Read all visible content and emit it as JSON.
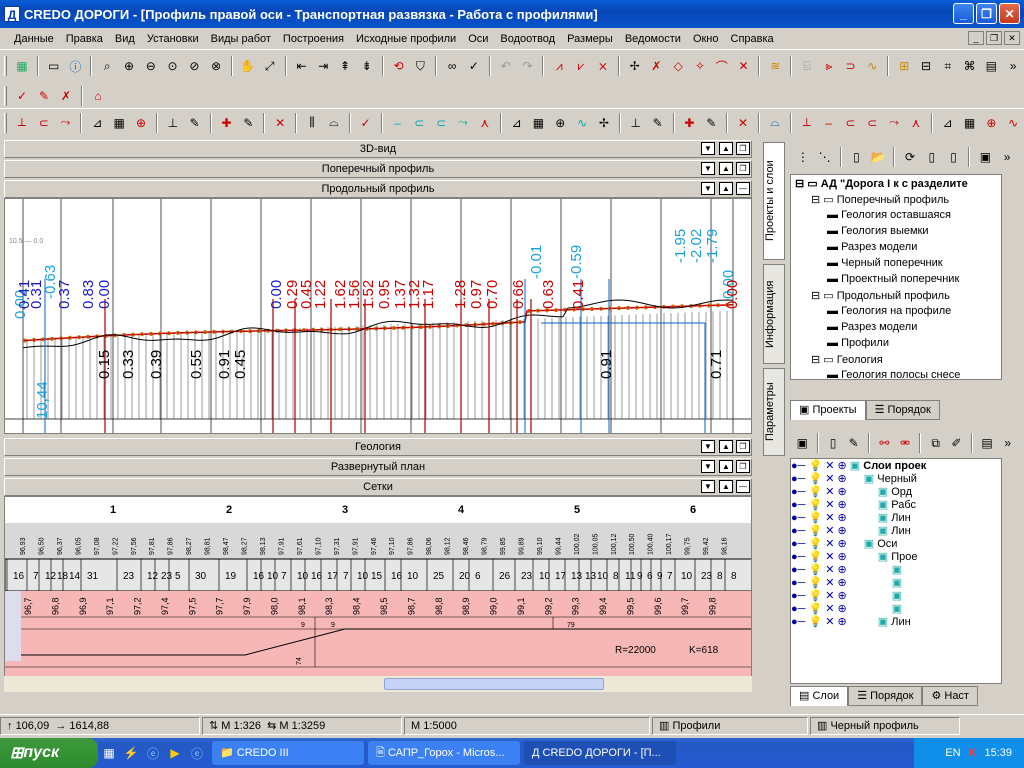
{
  "window": {
    "title": "CREDO ДОРОГИ - [Профиль правой оси - Транспортная развязка - Работа с профилями]",
    "app_icon": "Д"
  },
  "menu": [
    "Данные",
    "Правка",
    "Вид",
    "Установки",
    "Виды работ",
    "Построения",
    "Исходные профили",
    "Оси",
    "Водоотвод",
    "Размеры",
    "Ведомости",
    "Окно",
    "Справка"
  ],
  "panels": {
    "view3d": "3D-вид",
    "cross": "Поперечный профиль",
    "longitudinal": "Продольный профиль",
    "geology": "Геология",
    "plan": "Развернутый план",
    "grids": "Сетки"
  },
  "profile": {
    "blue_labels": [
      "-0.01",
      "-0.59",
      "-1.95",
      "-2.02",
      "-1.79",
      "0.00",
      "-0.63",
      "0.00",
      "10,44"
    ],
    "red_labels": [
      "0.41",
      "0.31",
      "0.37",
      "0.83",
      "0.00",
      "0.00",
      "0.29",
      "0.45",
      "1.22",
      "1.62",
      "1.56",
      "1.52",
      "0.95",
      "1.37",
      "1.32",
      "1.17",
      "1.28",
      "0.97",
      "0.70",
      "0.66",
      "0.63",
      "0.41",
      "0.00"
    ],
    "black_labels": [
      "0.15",
      "0.33",
      "0.39",
      "0.55",
      "0.91",
      "0.45",
      "0.91",
      "0.71"
    ],
    "top_tick": "10.5 — 0.0"
  },
  "grid": {
    "km_marks": [
      "1",
      "2",
      "3",
      "4",
      "5",
      "6"
    ],
    "top_values": [
      "96,93",
      "96,50",
      "96,37",
      "96,05",
      "97,08",
      "97,22",
      "97,56",
      "97,81",
      "97,86",
      "98,27",
      "98,81",
      "98,47",
      "98,27",
      "98,13",
      "97,91",
      "97,61",
      "97,10",
      "97,31",
      "97,91",
      "97,46",
      "97,10",
      "97,86",
      "98,06",
      "98,12",
      "98,46",
      "98,79",
      "99,85",
      "99,89",
      "99,10",
      "99,44",
      "100,02",
      "100,05",
      "100,12",
      "100,50",
      "100,40",
      "100,17",
      "99,75",
      "99,42",
      "98,16"
    ],
    "segments": [
      "16",
      "7",
      "12",
      "18",
      "14",
      "31",
      "23",
      "12",
      "23",
      "5",
      "30",
      "19",
      "16",
      "10",
      "7",
      "10",
      "16",
      "17",
      "7",
      "10",
      "15",
      "16",
      "10",
      "25",
      "20",
      "6",
      "26",
      "23",
      "10",
      "17",
      "13",
      "13",
      "10",
      "8",
      "11",
      "9",
      "6",
      "9",
      "7",
      "10",
      "23",
      "8",
      "8"
    ],
    "pink_values": [
      "96,7",
      "96,8",
      "96,9",
      "97,1",
      "97,2",
      "97,4",
      "97,5",
      "97,7",
      "97,9",
      "98,0",
      "98,1",
      "98,3",
      "98,4",
      "98,5",
      "98,7",
      "98,8",
      "98,9",
      "99,0",
      "99,1",
      "99,2",
      "99,3",
      "99,4",
      "99,5",
      "99,6",
      "99,7",
      "99,8"
    ],
    "lower_numbers": [
      "9",
      "9",
      "79",
      "74"
    ],
    "radius": "R=22000",
    "k": "K=618"
  },
  "right": {
    "vtabs": [
      "Проекты и слои",
      "Информация",
      "Параметры"
    ],
    "tree": [
      {
        "label": "АД \"Дорога I к с разделите",
        "depth": 0,
        "bold": true
      },
      {
        "label": "Поперечный профиль",
        "depth": 1
      },
      {
        "label": "Геология оставшаяся",
        "depth": 2
      },
      {
        "label": "Геология выемки",
        "depth": 2
      },
      {
        "label": "Разрез модели",
        "depth": 2
      },
      {
        "label": "Черный поперечник",
        "depth": 2
      },
      {
        "label": "Проектный поперечник",
        "depth": 2
      },
      {
        "label": "Продольный профиль",
        "depth": 1
      },
      {
        "label": "Геология на профиле",
        "depth": 2
      },
      {
        "label": "Разрез модели",
        "depth": 2
      },
      {
        "label": "Профили",
        "depth": 2
      },
      {
        "label": "Геология",
        "depth": 1
      },
      {
        "label": "Геология полосы снесе",
        "depth": 2
      }
    ],
    "tabs_top": [
      "Проекты",
      "Порядок"
    ],
    "layers": [
      {
        "label": "Слои проек",
        "depth": 0,
        "bold": true
      },
      {
        "label": "Черный",
        "depth": 1
      },
      {
        "label": "Орд",
        "depth": 2
      },
      {
        "label": "Рабс",
        "depth": 2
      },
      {
        "label": "Лин",
        "depth": 2
      },
      {
        "label": "Лин",
        "depth": 2
      },
      {
        "label": "Оси",
        "depth": 1
      },
      {
        "label": "Прое",
        "depth": 2
      },
      {
        "label": "",
        "depth": 3
      },
      {
        "label": "",
        "depth": 3
      },
      {
        "label": "",
        "depth": 3
      },
      {
        "label": "",
        "depth": 3
      },
      {
        "label": "Лин",
        "depth": 2
      }
    ],
    "tabs_bottom": [
      "Слои",
      "Порядок",
      "Наст"
    ]
  },
  "status": {
    "coords_y": "106,09",
    "coords_x": "1614,88",
    "scale_v": "М 1:326",
    "scale_h": "М 1:3259",
    "scale_main": "М 1:5000",
    "active_layer": "Профили",
    "active_obj": "Черный профиль"
  },
  "taskbar": {
    "start": "пуск",
    "tasks": [
      "CREDO III",
      "САПР_Горох - Micros...",
      "CREDO ДОРОГИ - [П..."
    ],
    "lang": "EN",
    "clock": "15:39"
  }
}
